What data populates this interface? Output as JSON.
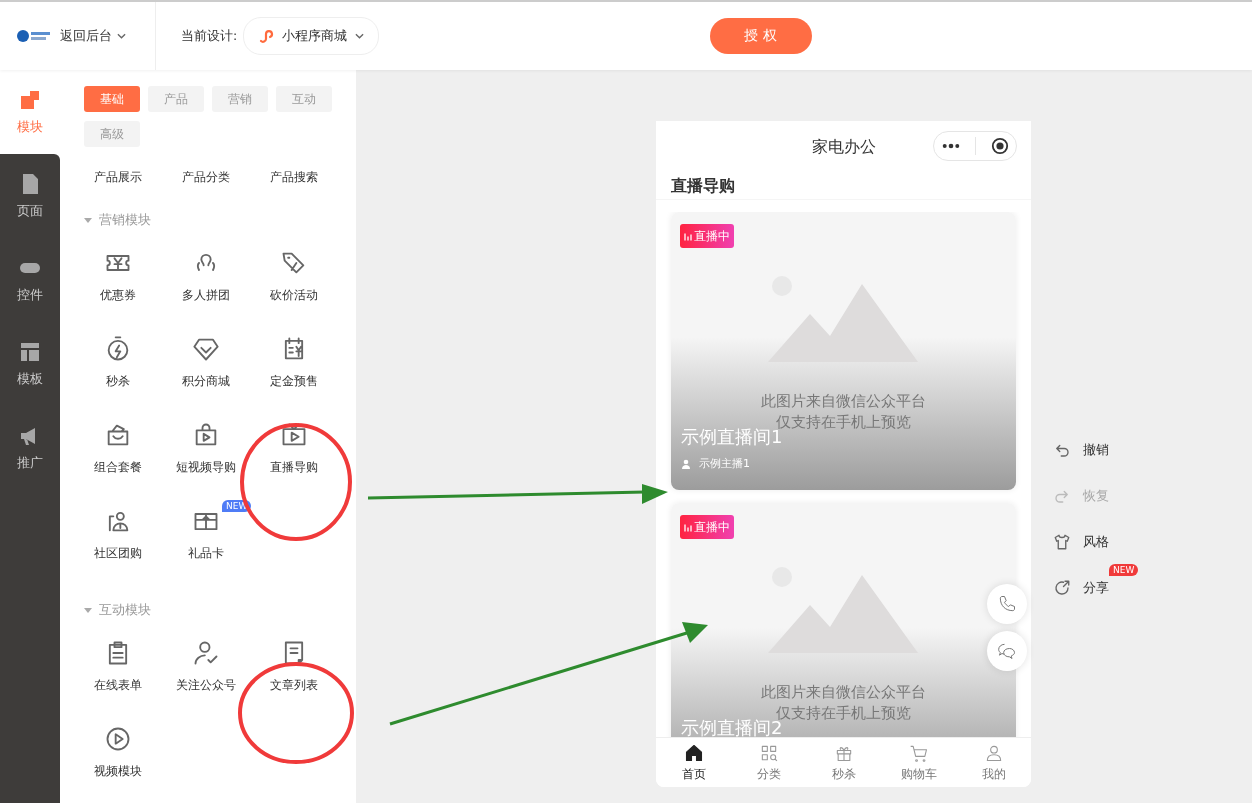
{
  "header": {
    "back_label": "返回后台",
    "design_label": "当前设计:",
    "design_select": "小程序商城",
    "authorize_button": "授 权"
  },
  "rail": [
    {
      "label": "模块",
      "kind": "blocks",
      "selected": true
    },
    {
      "label": "页面",
      "kind": "page",
      "selected": false
    },
    {
      "label": "控件",
      "kind": "toggle",
      "selected": false
    },
    {
      "label": "模板",
      "kind": "layout",
      "selected": false
    },
    {
      "label": "推广",
      "kind": "megaphone",
      "selected": false
    }
  ],
  "category_tabs": [
    {
      "label": "基础",
      "selected": true
    },
    {
      "label": "产品",
      "selected": false
    },
    {
      "label": "营销",
      "selected": false
    },
    {
      "label": "互动",
      "selected": false
    },
    {
      "label": "高级",
      "selected": false
    }
  ],
  "basic_items": [
    "产品展示",
    "产品分类",
    "产品搜索"
  ],
  "sections": [
    {
      "title": "营销模块",
      "items": [
        {
          "label": "优惠券",
          "kind": "coupon"
        },
        {
          "label": "多人拼团",
          "kind": "group"
        },
        {
          "label": "砍价活动",
          "kind": "tag"
        },
        {
          "label": "秒杀",
          "kind": "timer"
        },
        {
          "label": "积分商城",
          "kind": "gem"
        },
        {
          "label": "定金预售",
          "kind": "presale"
        },
        {
          "label": "组合套餐",
          "kind": "bag"
        },
        {
          "label": "短视频导购",
          "kind": "shopvideo"
        },
        {
          "label": "直播导购",
          "kind": "tv"
        },
        {
          "label": "社区团购",
          "kind": "community"
        },
        {
          "label": "礼品卡",
          "kind": "giftcard",
          "badge": "NEW"
        }
      ]
    },
    {
      "title": "互动模块",
      "items": [
        {
          "label": "在线表单",
          "kind": "form"
        },
        {
          "label": "关注公众号",
          "kind": "follow"
        },
        {
          "label": "文章列表",
          "kind": "article"
        },
        {
          "label": "视频模块",
          "kind": "play"
        }
      ]
    }
  ],
  "phone": {
    "title": "家电办公",
    "section_title": "直播导购",
    "cards": [
      {
        "badge": "直播中",
        "placeholder_lines": [
          "此图片来自微信公众平台",
          "仅支持在手机上预览"
        ],
        "title": "示例直播间1",
        "host": "示例主播1"
      },
      {
        "badge": "直播中",
        "placeholder_lines": [
          "此图片来自微信公众平台",
          "仅支持在手机上预览"
        ],
        "title": "示例直播间2"
      }
    ],
    "tabbar": [
      {
        "label": "首页",
        "kind": "home",
        "selected": true
      },
      {
        "label": "分类",
        "kind": "grid",
        "selected": false
      },
      {
        "label": "秒杀",
        "kind": "gift",
        "selected": false
      },
      {
        "label": "购物车",
        "kind": "cart",
        "selected": false
      },
      {
        "label": "我的",
        "kind": "user",
        "selected": false
      }
    ]
  },
  "side_tools": [
    {
      "label": "撤销",
      "kind": "undo",
      "disabled": false
    },
    {
      "label": "恢复",
      "kind": "redo",
      "disabled": true
    },
    {
      "label": "风格",
      "kind": "shirt",
      "disabled": false
    },
    {
      "label": "分享",
      "kind": "share",
      "disabled": false,
      "badge": "NEW"
    }
  ]
}
